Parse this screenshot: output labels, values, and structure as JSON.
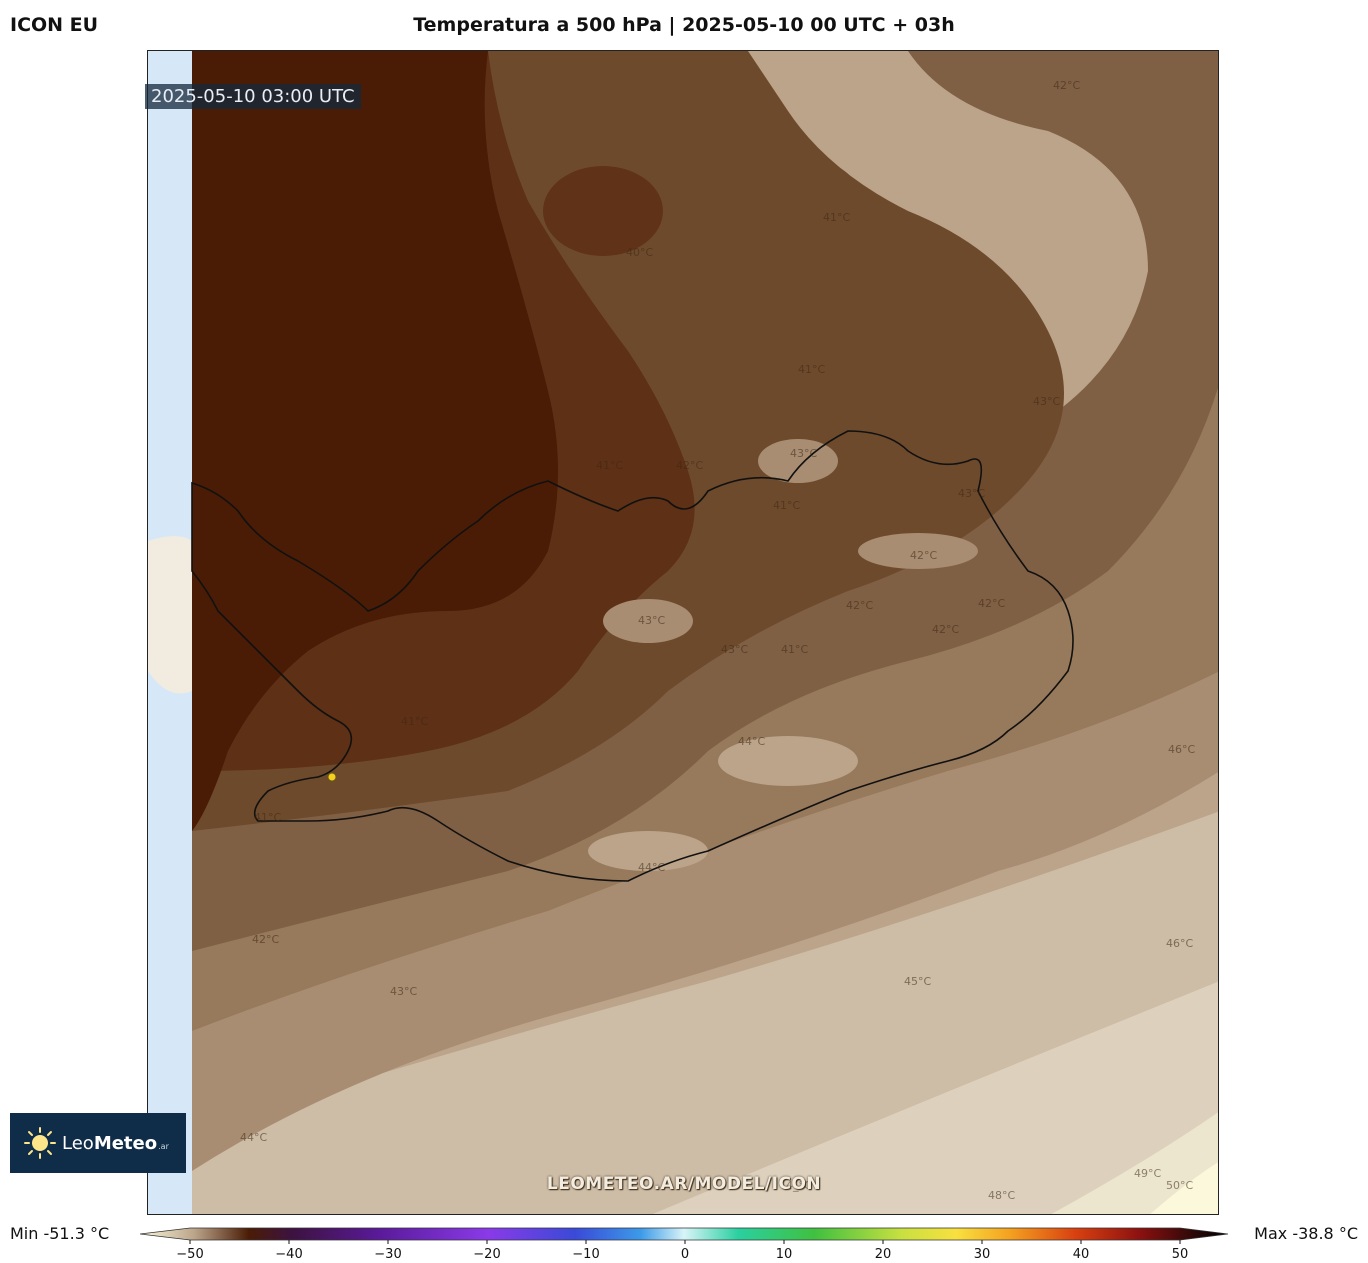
{
  "header": {
    "model": "ICON EU",
    "title": "Temperatura a 500 hPa | 2025-05-10 00 UTC + 03h"
  },
  "map": {
    "valid_time": "2025-05-10 03:00 UTC",
    "watermark": "LEOMETEO.AR/MODEL/ICON",
    "contour_labels": [
      "42°C",
      "41°C",
      "40°C",
      "41°C",
      "43°C",
      "41°C",
      "42°C",
      "43°C",
      "41°C",
      "43°C",
      "42°C",
      "43°C",
      "42°C",
      "42°C",
      "43°C",
      "42°C",
      "41°C",
      "41°C",
      "44°C",
      "46°C",
      "41°C",
      "44°C",
      "42°C",
      "43°C",
      "45°C",
      "46°C",
      "44°C",
      "49°C",
      "48°C",
      "50°C",
      "4_°C"
    ],
    "colors": {
      "sea_light": "#d6e8f8",
      "land_light": "#f2ebe0",
      "t_40": "#4a1c05",
      "t_41": "#5e3015",
      "t_42": "#6e4a2c",
      "t_43": "#806045",
      "t_44": "#97795c",
      "t_45": "#a88d72",
      "t_46": "#bba48a",
      "t_47": "#cdbca6",
      "t_48": "#ddd1bd",
      "t_49": "#ede6cf",
      "t_50": "#fbf8dc"
    }
  },
  "legend": {
    "min_label": "Min -51.3 °C",
    "max_label": "Max -38.8 °C",
    "ticks": [
      "−50",
      "−40",
      "−30",
      "−20",
      "−10",
      "0",
      "10",
      "20",
      "30",
      "40",
      "50"
    ]
  },
  "logo": {
    "name_light": "Leo",
    "name_bold": "Meteo",
    "suffix": ".ar"
  }
}
